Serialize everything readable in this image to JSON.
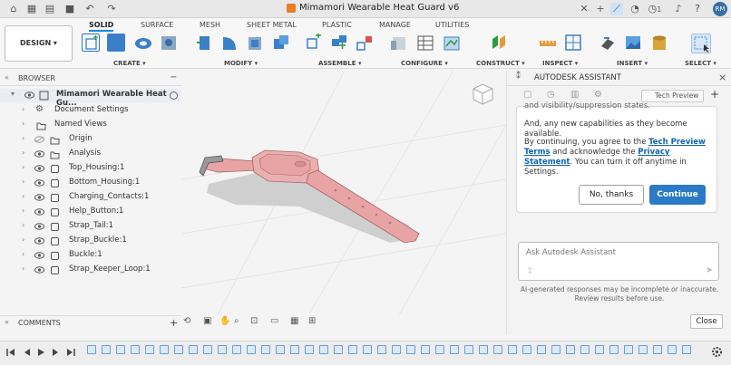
{
  "title_bar": {
    "document_title": "Mimamori Wearable Heat Guard v6",
    "job_count": "1",
    "user_initials": "RM"
  },
  "toolbar": {
    "workspace": "DESIGN",
    "tabs": [
      "SOLID",
      "SURFACE",
      "MESH",
      "SHEET METAL",
      "PLASTIC",
      "MANAGE",
      "UTILITIES"
    ],
    "groups": [
      "CREATE",
      "MODIFY",
      "ASSEMBLE",
      "CONFIGURE",
      "CONSTRUCT",
      "INSPECT",
      "INSERT",
      "SELECT"
    ]
  },
  "browser": {
    "label": "BROWSER",
    "root": "Mimamori Wearable Heat Gu...",
    "items": [
      {
        "label": "Document Settings",
        "icon": "gear-icon"
      },
      {
        "label": "Named Views",
        "icon": "folder-icon"
      },
      {
        "label": "Origin",
        "icon": "folder-icon"
      },
      {
        "label": "Analysis",
        "icon": "folder-icon"
      },
      {
        "label": "Top_Housing:1",
        "icon": "component-icon"
      },
      {
        "label": "Bottom_Housing:1",
        "icon": "component-icon"
      },
      {
        "label": "Charging_Contacts:1",
        "icon": "component-icon"
      },
      {
        "label": "Help_Button:1",
        "icon": "component-icon"
      },
      {
        "label": "Strap_Tail:1",
        "icon": "component-icon"
      },
      {
        "label": "Strap_Buckle:1",
        "icon": "component-icon"
      },
      {
        "label": "Buckle:1",
        "icon": "component-icon"
      },
      {
        "label": "Strap_Keeper_Loop:1",
        "icon": "component-icon"
      }
    ]
  },
  "comments": {
    "label": "COMMENTS"
  },
  "assistant": {
    "title": "AUTODESK ASSISTANT",
    "tech_preview": "Tech Preview",
    "clipped_line": "and visibility/suppression states.",
    "paragraph1": "And, any new capabilities as they become available.",
    "consent_prefix": "By continuing, you agree to the",
    "terms_link": "Tech Preview Terms",
    "consent_mid": "and acknowledge the",
    "privacy_link": "Privacy Statement",
    "consent_suffix": ". You can turn it off anytime in Settings.",
    "no_button": "No, thanks",
    "continue_button": "Continue",
    "input_placeholder": "Ask Autodesk Assistant",
    "disclaimer_line1": "AI-generated responses may be incomplete or inaccurate.",
    "disclaimer_line2": "Review results before use.",
    "close_button": "Close"
  },
  "colors": {
    "model": "#e8a4a4",
    "accent_blue": "#2a7ac6",
    "link": "#0b63b5"
  }
}
